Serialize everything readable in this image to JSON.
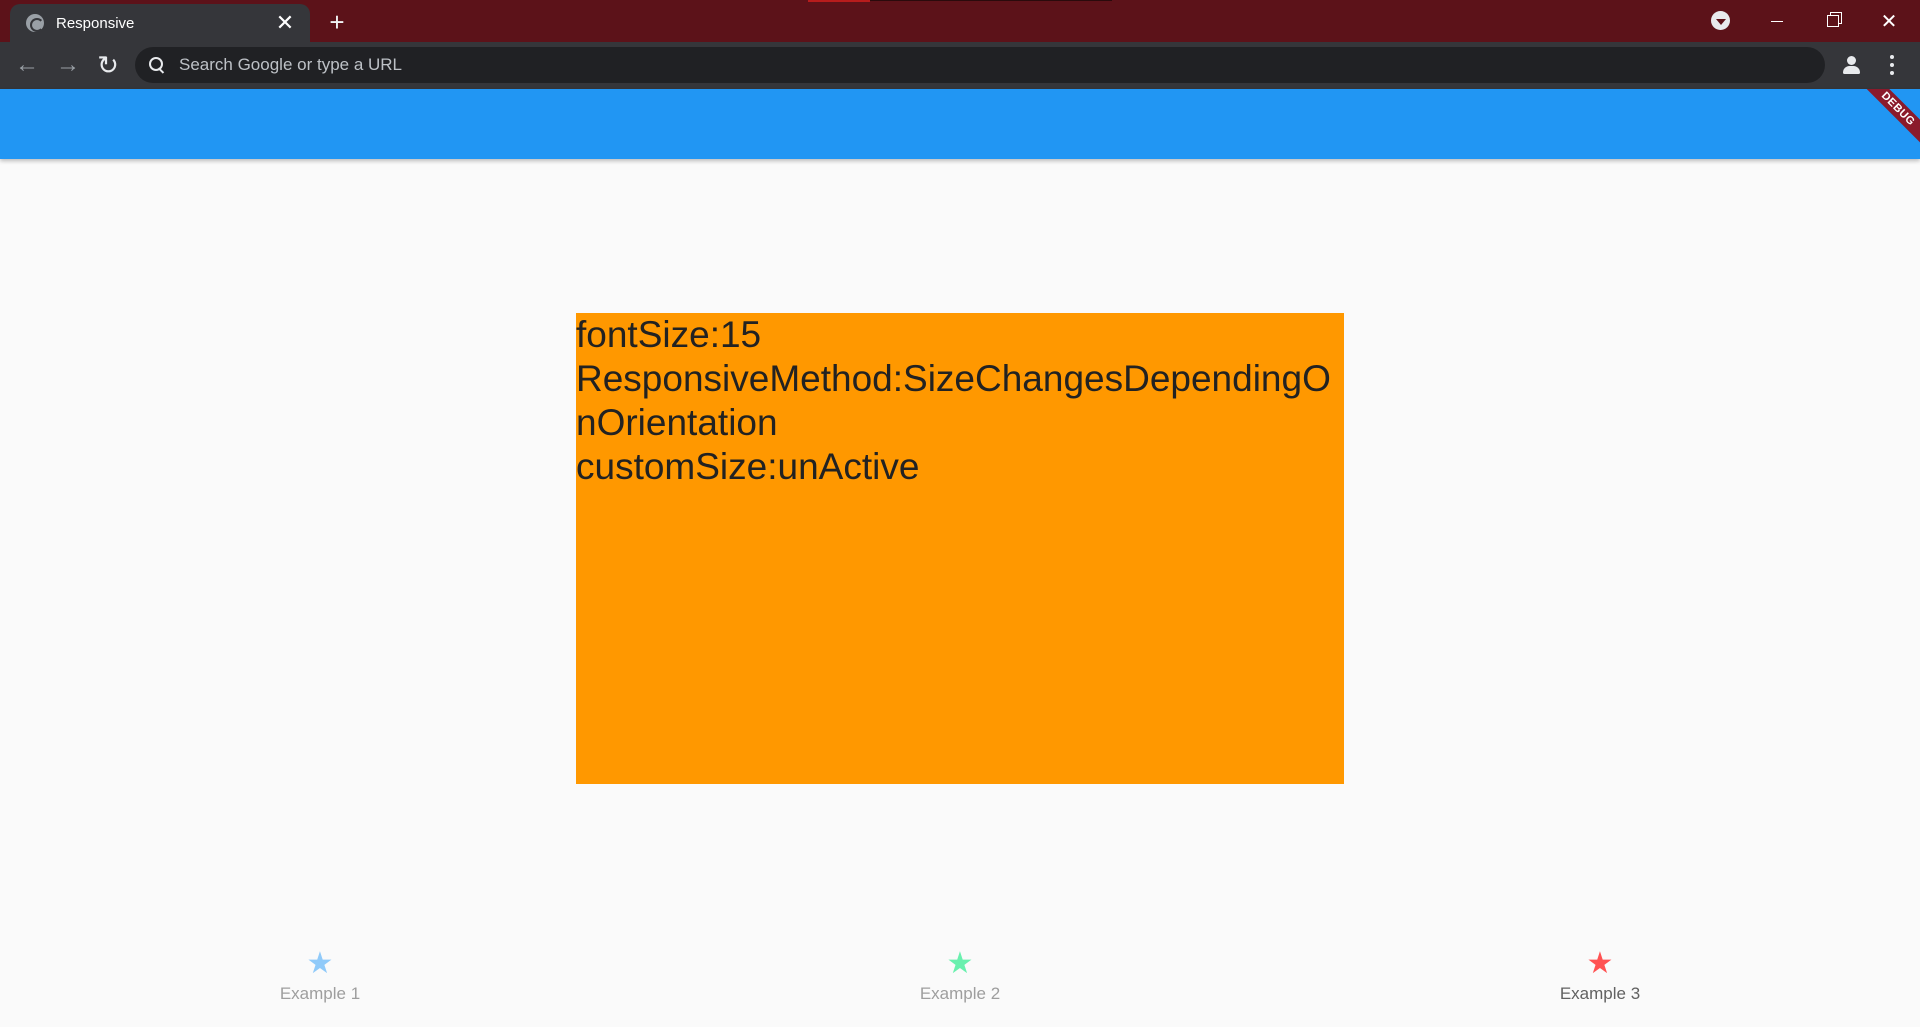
{
  "browser": {
    "tab_title": "Responsive",
    "tab_close": "✕",
    "new_tab": "+",
    "back": "←",
    "forward": "→",
    "reload": "↻",
    "omnibox_placeholder": "Search Google or type a URL",
    "window_controls": {
      "minimize": "—",
      "restore": "❐",
      "close": "✕"
    }
  },
  "app": {
    "app_bar_color": "#2196f3",
    "debug_banner": "DEBUG",
    "content": {
      "background": "#ff9800",
      "line1": "fontSize:15",
      "line2": "ResponsiveMethod:SizeChangesDependingOnOrientation",
      "line3": "customSize:unActive"
    },
    "bottom_nav": {
      "items": [
        {
          "label": "Example 1",
          "icon": "star-icon",
          "color": "#90caf9",
          "selected": false
        },
        {
          "label": "Example 2",
          "icon": "star-icon",
          "color": "#69f0ae",
          "selected": false
        },
        {
          "label": "Example 3",
          "icon": "star-icon",
          "color": "#ff5252",
          "selected": true
        }
      ],
      "star_glyph": "★"
    }
  }
}
